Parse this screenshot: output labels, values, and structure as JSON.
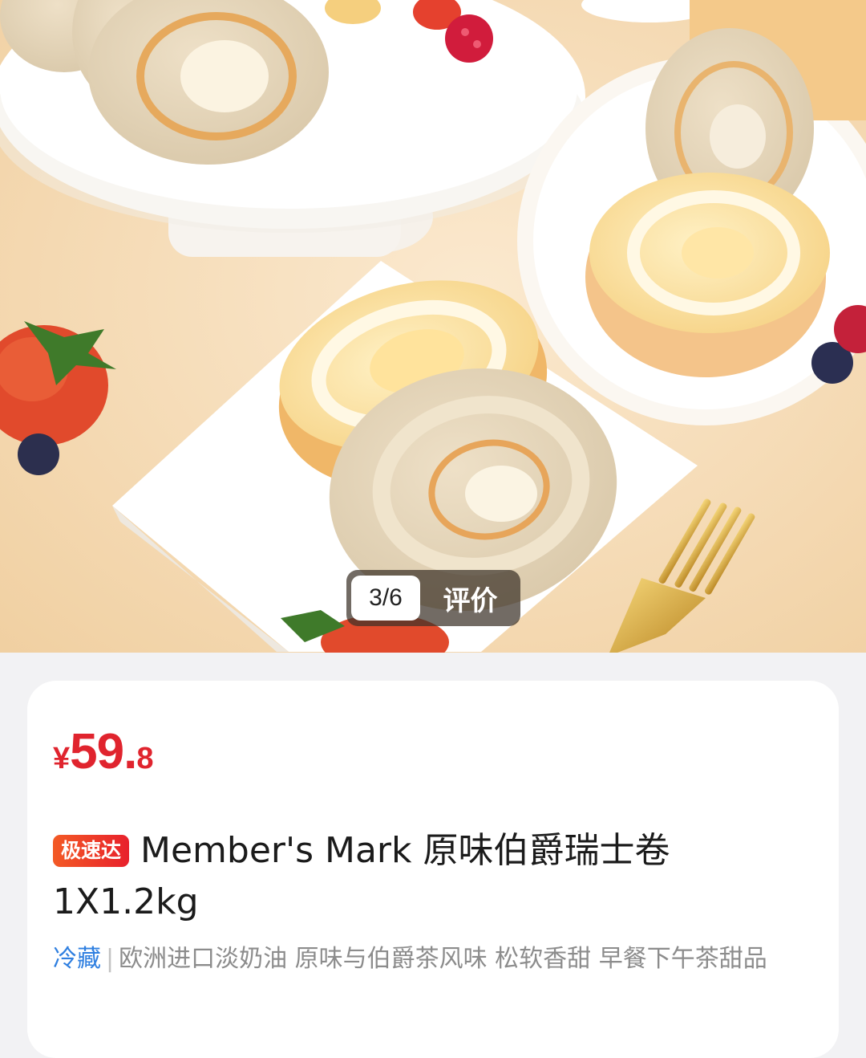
{
  "gallery": {
    "current_index": "3/6",
    "review_label": "评价"
  },
  "product": {
    "price_currency": "¥",
    "price_integer": "59.",
    "price_decimal": "8",
    "badge": "极速达",
    "title": "Member's Mark 原味伯爵瑞士卷 1X1.2kg",
    "storage_tag": "冷藏",
    "separator": "|",
    "description": "欧洲进口淡奶油 原味与伯爵茶风味 松软香甜 早餐下午茶甜品"
  },
  "colors": {
    "price": "#e0242e",
    "badge_start": "#f35a25",
    "badge_end": "#e8212c",
    "storage_tag": "#2f7fe0",
    "page_background": "#f2f2f4"
  }
}
